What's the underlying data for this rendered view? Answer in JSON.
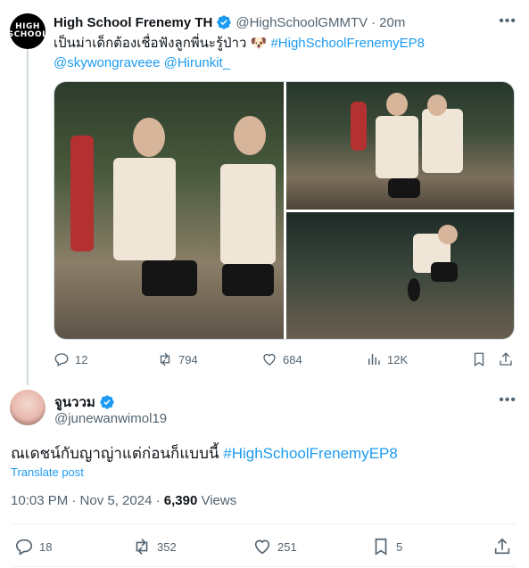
{
  "parent": {
    "name": "High School Frenemy TH",
    "handle": "@HighSchoolGMMTV",
    "dot": "·",
    "time": "20m",
    "text_thai": "เป็นม่าเด็กต้องเชื่อฟังลูกพี่นะรู้ป่าว",
    "emoji": "🐶",
    "hashtag": "#HighSchoolFrenemyEP8",
    "mentions": "@skywongraveee @Hirunkit_",
    "avatar_label": "HIGH SCHOOL",
    "actions": {
      "replies": "12",
      "reposts": "794",
      "likes": "684",
      "views": "12K"
    }
  },
  "reply": {
    "name": "จูนววม",
    "handle": "@junewanwimol19",
    "text_thai": "ณเดชน์กับญาญ่าแต่ก่อนก็แบบนี้",
    "hashtag": "#HighSchoolFrenemyEP8",
    "translate": "Translate post",
    "timestamp": "10:03 PM · Nov 5, 2024 · ",
    "views_count": "6,390",
    "views_label": " Views",
    "actions": {
      "replies": "18",
      "reposts": "352",
      "likes": "251",
      "bookmarks": "5"
    }
  },
  "colors": {
    "accent": "#1d9bf0",
    "secondary_text": "#536471",
    "primary_text": "#0f1419"
  }
}
